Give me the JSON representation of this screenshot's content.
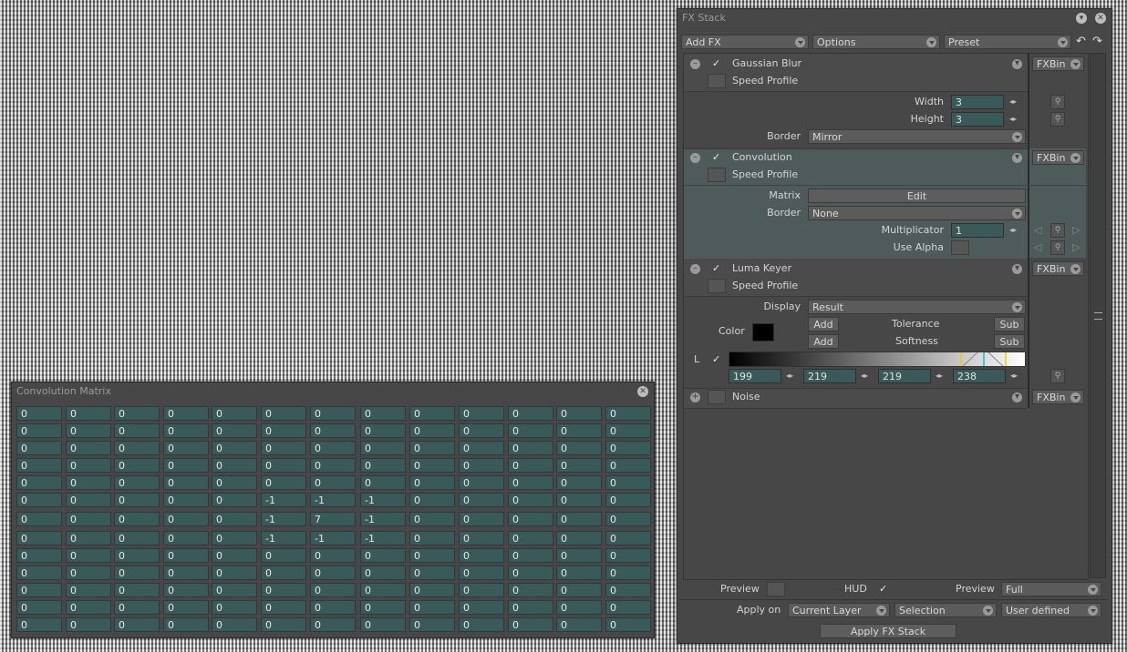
{
  "fx_stack": {
    "title": "FX Stack",
    "add_fx": "Add FX",
    "options": "Options",
    "preset": "Preset",
    "fxbin": "FXBin",
    "speed_profile": "Speed Profile",
    "gaussian": {
      "name": "Gaussian Blur",
      "width_label": "Width",
      "width": "3",
      "height_label": "Height",
      "height": "3",
      "border_label": "Border",
      "border": "Mirror"
    },
    "convolution": {
      "name": "Convolution",
      "matrix_label": "Matrix",
      "edit": "Edit",
      "border_label": "Border",
      "border": "None",
      "mult_label": "Multiplicator",
      "mult": "1",
      "alpha_label": "Use Alpha"
    },
    "luma": {
      "name": "Luma Keyer",
      "display_label": "Display",
      "display": "Result",
      "color_label": "Color",
      "add": "Add",
      "sub": "Sub",
      "tolerance": "Tolerance",
      "softness": "Softness",
      "l_label": "L",
      "v1": "199",
      "v2": "219",
      "v3": "219",
      "v4": "238"
    },
    "noise": {
      "name": "Noise"
    },
    "bottom": {
      "preview_label": "Preview",
      "hud_label": "HUD",
      "preview2_label": "Preview",
      "preview2": "Full",
      "apply_on_label": "Apply on",
      "apply_on": "Current Layer",
      "selection": "Selection",
      "user_defined": "User defined",
      "apply_button": "Apply FX Stack"
    }
  },
  "matrix": {
    "title": "Convolution Matrix",
    "rows": [
      [
        "0",
        "0",
        "0",
        "0",
        "0",
        "0",
        "0",
        "0",
        "0",
        "0",
        "0",
        "0",
        "0"
      ],
      [
        "0",
        "0",
        "0",
        "0",
        "0",
        "0",
        "0",
        "0",
        "0",
        "0",
        "0",
        "0",
        "0"
      ],
      [
        "0",
        "0",
        "0",
        "0",
        "0",
        "0",
        "0",
        "0",
        "0",
        "0",
        "0",
        "0",
        "0"
      ],
      [
        "0",
        "0",
        "0",
        "0",
        "0",
        "0",
        "0",
        "0",
        "0",
        "0",
        "0",
        "0",
        "0"
      ],
      [
        "0",
        "0",
        "0",
        "0",
        "0",
        "0",
        "0",
        "0",
        "0",
        "0",
        "0",
        "0",
        "0"
      ],
      [
        "0",
        "0",
        "0",
        "0",
        "0",
        "-1",
        "-1",
        "-1",
        "0",
        "0",
        "0",
        "0",
        "0"
      ],
      [
        "0",
        "0",
        "0",
        "0",
        "0",
        "-1",
        "7",
        "-1",
        "0",
        "0",
        "0",
        "0",
        "0"
      ],
      [
        "0",
        "0",
        "0",
        "0",
        "0",
        "-1",
        "-1",
        "-1",
        "0",
        "0",
        "0",
        "0",
        "0"
      ],
      [
        "0",
        "0",
        "0",
        "0",
        "0",
        "0",
        "0",
        "0",
        "0",
        "0",
        "0",
        "0",
        "0"
      ],
      [
        "0",
        "0",
        "0",
        "0",
        "0",
        "0",
        "0",
        "0",
        "0",
        "0",
        "0",
        "0",
        "0"
      ],
      [
        "0",
        "0",
        "0",
        "0",
        "0",
        "0",
        "0",
        "0",
        "0",
        "0",
        "0",
        "0",
        "0"
      ],
      [
        "0",
        "0",
        "0",
        "0",
        "0",
        "0",
        "0",
        "0",
        "0",
        "0",
        "0",
        "0",
        "0"
      ],
      [
        "0",
        "0",
        "0",
        "0",
        "0",
        "0",
        "0",
        "0",
        "0",
        "0",
        "0",
        "0",
        "0"
      ]
    ]
  }
}
